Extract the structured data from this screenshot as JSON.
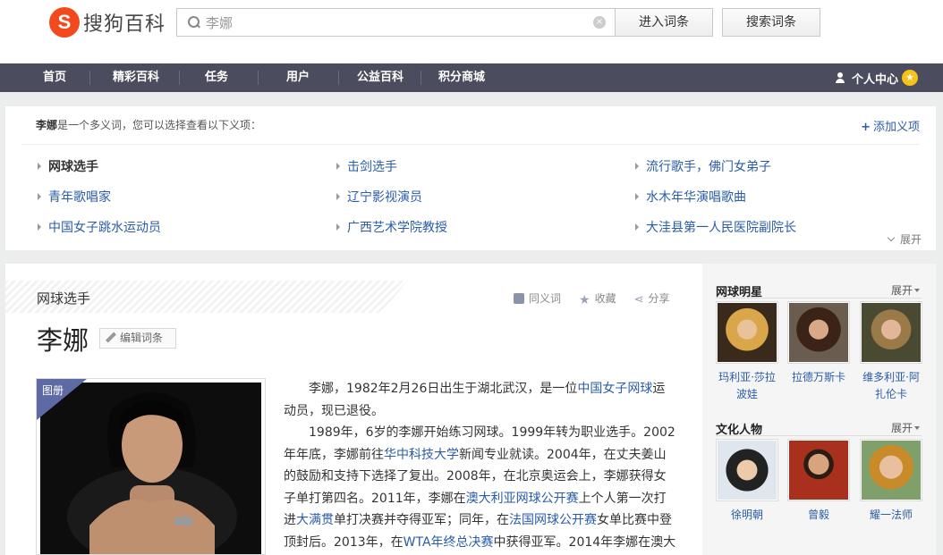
{
  "header": {
    "logo_mark": "S",
    "logo_text": "搜狗百科",
    "search_value": "李娜",
    "enter_button": "进入词条",
    "search_button": "搜索词条"
  },
  "nav": {
    "items": [
      "首页",
      "精彩百科",
      "任务",
      "用户",
      "公益百科",
      "积分商城"
    ],
    "user_center": "个人中心"
  },
  "disambiguation": {
    "term": "李娜",
    "intro": "是一个多义词，您可以选择查看以下义项：",
    "add_sense": "添加义项",
    "expand": "展开",
    "senses": [
      "网球选手",
      "击剑选手",
      "流行歌手，佛门女弟子",
      "青年歌唱家",
      "辽宁影视演员",
      "水木年华演唱歌曲",
      "中国女子跳水运动员",
      "广西艺术学院教授",
      "大洼县第一人民医院副院长"
    ]
  },
  "entry": {
    "sense_banner": "网球选手",
    "title": "李娜",
    "edit_button": "编辑词条",
    "tools": {
      "synonym": "同义词",
      "favorite": "收藏",
      "share": "分享"
    },
    "album_label": "图册",
    "para1": {
      "t1": "李娜，1982年2月26日出生于湖北武汉，是一位",
      "l1": "中国女子网球",
      "t2": "运动员，现已退役。"
    },
    "para2": {
      "t1": "1989年，6岁的李娜开始练习网球。1999年转为职业选手。2002年年底，李娜前往",
      "l1": "华中科技大学",
      "t2": "新闻专业就读。2004年，在丈夫姜山的鼓励和支持下选择了复出。2008年，在北京奥运会上，李娜获得女子单打第四名。2011年，李娜在",
      "l2": "澳大利亚网球公开赛",
      "t3": "上个人第一次打进",
      "l3": "大满贯",
      "t4": "单打决赛并夺得亚军；同年，在",
      "l4": "法国网球公开赛",
      "t5": "女单比赛中登顶封后。2013年，在",
      "l5": "WTA年终总决赛",
      "t6": "中获得亚军。2014年李娜在澳大"
    }
  },
  "sidebar": {
    "sections": [
      {
        "title": "网球明星",
        "more": "展开",
        "people": [
          {
            "name": "玛利亚·莎拉波娃"
          },
          {
            "name": "拉德万斯卡"
          },
          {
            "name": "维多利亚·阿扎伦卡"
          }
        ]
      },
      {
        "title": "文化人物",
        "more": "展开",
        "people": [
          {
            "name": "徐明朝"
          },
          {
            "name": "曾毅"
          },
          {
            "name": "耀一法师"
          }
        ]
      }
    ]
  },
  "colors": {
    "nav_bg": "#4b4d5e",
    "link": "#2a5ca8",
    "logo": "#f2491d",
    "album_tag": "#5d6aa3"
  }
}
